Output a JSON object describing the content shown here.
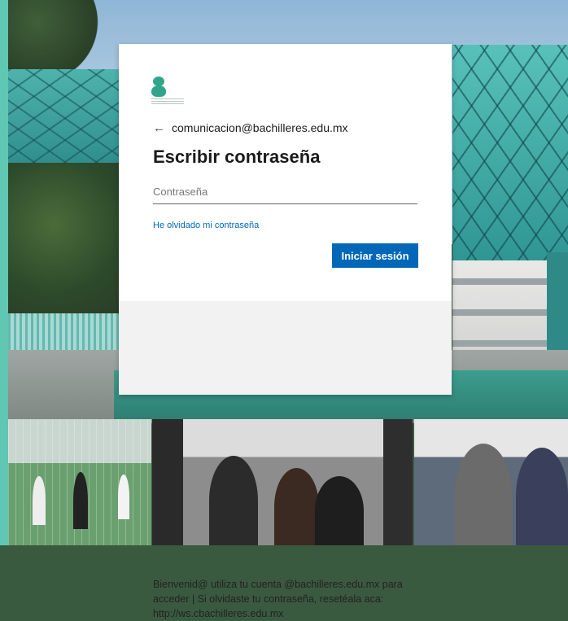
{
  "login": {
    "account_email": "comunicacion@bachilleres.edu.mx",
    "title": "Escribir contraseña",
    "password_placeholder": "Contraseña",
    "forgot_password_link": "He olvidado mi contraseña",
    "signin_button": "Iniciar sesión",
    "back_icon": "arrow-left-icon"
  },
  "footer": {
    "message": "Bienvenid@ utiliza tu cuenta @bachilleres.edu.mx para acceder | Si olvidaste tu contraseña, resetéala aca: http://ws.cbachilleres.edu.mx"
  },
  "colors": {
    "accent": "#0067b8",
    "logo": "#2fa58c",
    "teal": "#5fc7b2"
  }
}
